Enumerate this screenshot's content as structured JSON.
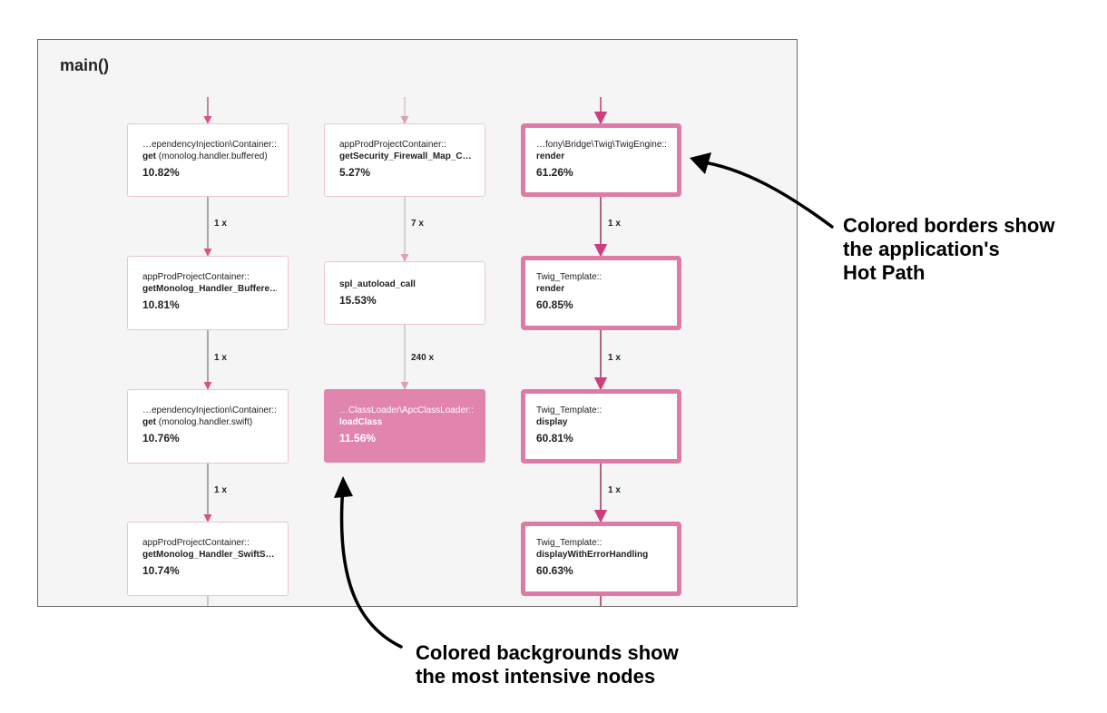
{
  "panel": {
    "title": "main()"
  },
  "nodes": [
    {
      "id": "n1",
      "cls": "…ependencyInjection\\Container::",
      "fn": "get",
      "arg": " (monolog.handler.buffered)",
      "pct": "10.82%"
    },
    {
      "id": "n2",
      "cls": "appProdProjectContainer::",
      "fn": "getMonolog_Handler_Buffere…",
      "arg": "",
      "pct": "10.81%"
    },
    {
      "id": "n3",
      "cls": "…ependencyInjection\\Container::",
      "fn": "get",
      "arg": " (monolog.handler.swift)",
      "pct": "10.76%"
    },
    {
      "id": "n4",
      "cls": "appProdProjectContainer::",
      "fn": "getMonolog_Handler_SwiftS…",
      "arg": "",
      "pct": "10.74%"
    },
    {
      "id": "n5",
      "cls": "appProdProjectContainer::",
      "fn": "getSecurity_Firewall_Map_C…",
      "arg": "",
      "pct": "5.27%"
    },
    {
      "id": "n6",
      "cls": "",
      "fn": "spl_autoload_call",
      "arg": "",
      "pct": "15.53%"
    },
    {
      "id": "n7",
      "cls": "…ClassLoader\\ApcClassLoader::",
      "fn": "loadClass",
      "arg": "",
      "pct": "11.56%"
    },
    {
      "id": "n8",
      "cls": "…fony\\Bridge\\Twig\\TwigEngine::",
      "fn": "render",
      "arg": "",
      "pct": "61.26%"
    },
    {
      "id": "n9",
      "cls": "Twig_Template::",
      "fn": "render",
      "arg": "",
      "pct": "60.85%"
    },
    {
      "id": "n10",
      "cls": "Twig_Template::",
      "fn": "display",
      "arg": "",
      "pct": "60.81%"
    },
    {
      "id": "n11",
      "cls": "Twig_Template::",
      "fn": "displayWithErrorHandling",
      "arg": "",
      "pct": "60.63%"
    }
  ],
  "edges": [
    {
      "from": "n1",
      "to": "n2",
      "label": "1 x"
    },
    {
      "from": "n2",
      "to": "n3",
      "label": "1 x"
    },
    {
      "from": "n3",
      "to": "n4",
      "label": "1 x"
    },
    {
      "from": "n5",
      "to": "n6",
      "label": "7 x"
    },
    {
      "from": "n6",
      "to": "n7",
      "label": "240 x"
    },
    {
      "from": "n8",
      "to": "n9",
      "label": "1 x"
    },
    {
      "from": "n9",
      "to": "n10",
      "label": "1 x"
    },
    {
      "from": "n10",
      "to": "n11",
      "label": "1 x"
    }
  ],
  "annotations": {
    "hot_path": [
      "Colored borders show",
      "the application's",
      "Hot Path"
    ],
    "intensive": [
      "Colored backgrounds show",
      "the most intensive nodes"
    ]
  },
  "colors": {
    "hot_border": "#dd7aa6",
    "intense_fill": "#e184ae",
    "hot_edge": "#cc3f7c",
    "edge_gray": "#7a7a7a",
    "edge_light": "#c9a9b6",
    "edge_pink": "#d9508c"
  }
}
